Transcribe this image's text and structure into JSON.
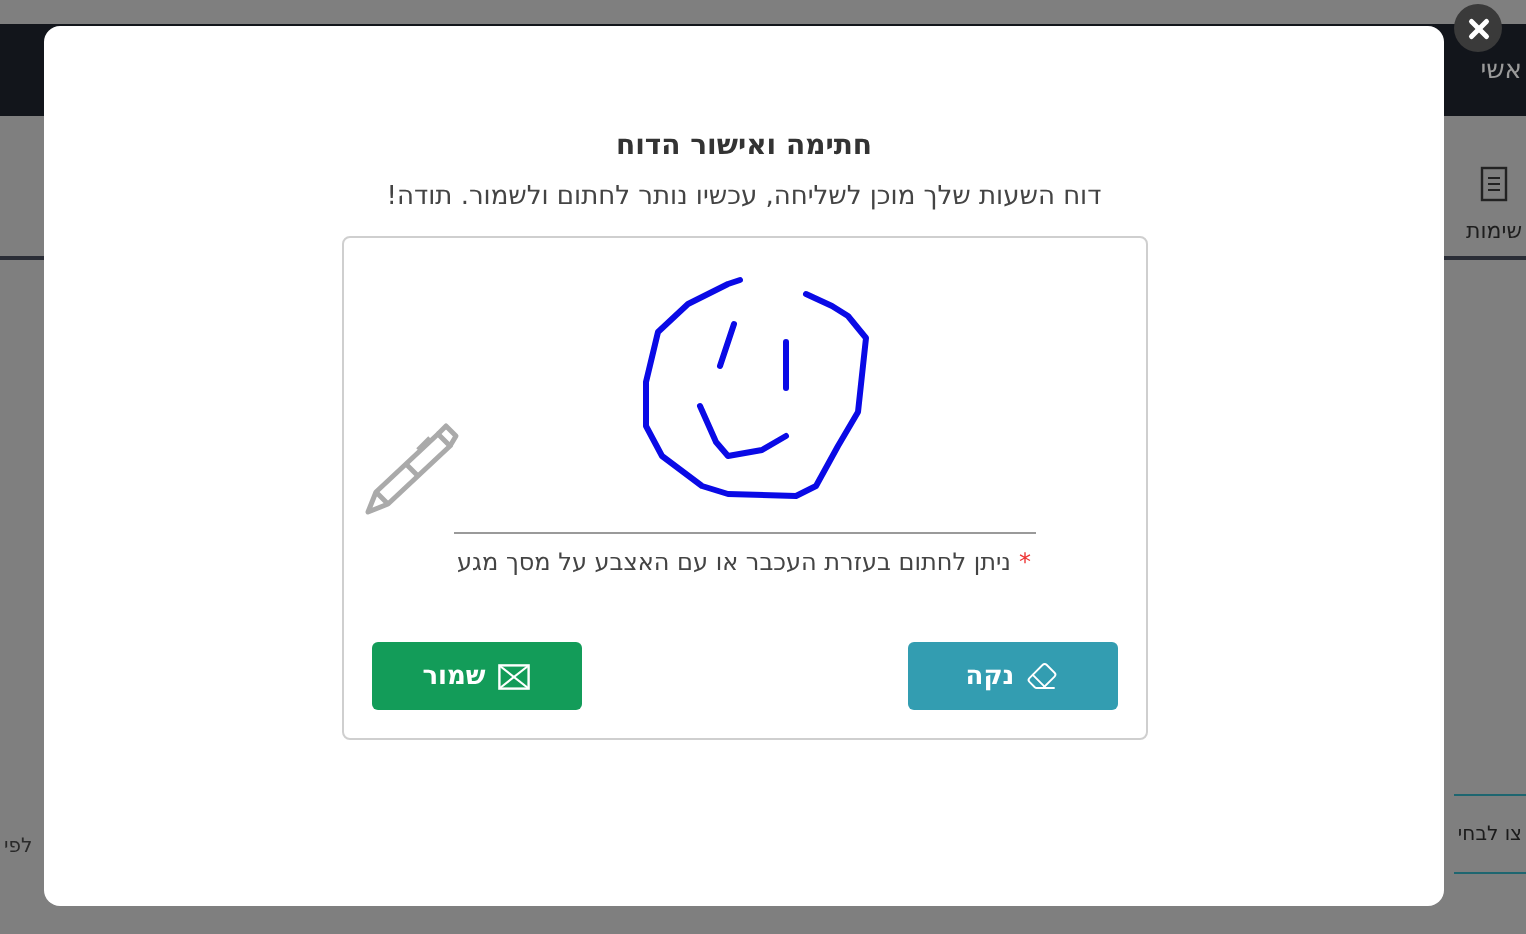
{
  "background": {
    "header_title": "אשי",
    "tab_label": "שימות",
    "side_button": "צו לבחי",
    "side_text": "לפי"
  },
  "dialog": {
    "title": "חתימה ואישור הדוח",
    "subtitle": "דוח השעות שלך מוכן לשליחה, עכשיו נותר לחתום ולשמור. תודה!",
    "required_mark": "*",
    "hint": "ניתן לחתום בעזרת העכבר או עם האצבע על מסך מגע",
    "buttons": [
      {
        "kind": "clear",
        "label": "נקה"
      },
      {
        "kind": "save",
        "label": "שמור"
      }
    ]
  }
}
